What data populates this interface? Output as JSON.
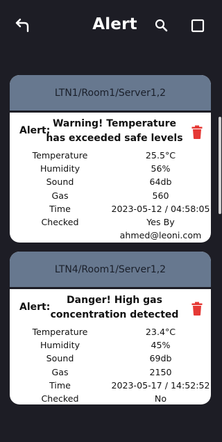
{
  "header": {
    "title": "Alert"
  },
  "cards": [
    {
      "location": "LTN1/Room1/Server1,2",
      "alert_label": "Alert:",
      "message": "Warning! Temperature has exceeded safe levels",
      "fields": [
        {
          "label": "Temperature",
          "value": "25.5°C"
        },
        {
          "label": "Humidity",
          "value": "56%"
        },
        {
          "label": "Sound",
          "value": "64db"
        },
        {
          "label": "Gas",
          "value": "560"
        },
        {
          "label": "Time",
          "value": "2023-05-12 / 04:58:05"
        },
        {
          "label": "Checked",
          "value": "Yes By ahmed@leoni.com"
        }
      ]
    },
    {
      "location": "LTN4/Room1/Server1,2",
      "alert_label": "Alert:",
      "message": "Danger! High gas concentration detected",
      "fields": [
        {
          "label": "Temperature",
          "value": "23.4°C"
        },
        {
          "label": "Humidity",
          "value": "45%"
        },
        {
          "label": "Sound",
          "value": "69db"
        },
        {
          "label": "Gas",
          "value": "2150"
        },
        {
          "label": "Time",
          "value": "2023-05-17 / 14:52:52"
        },
        {
          "label": "Checked",
          "value": "No"
        }
      ]
    }
  ],
  "colors": {
    "background": "#1d1d25",
    "card_header": "#67788f",
    "delete_red": "#e53935"
  },
  "icons": [
    "back-arrow-icon",
    "search-icon",
    "window-icon",
    "trash-icon"
  ]
}
